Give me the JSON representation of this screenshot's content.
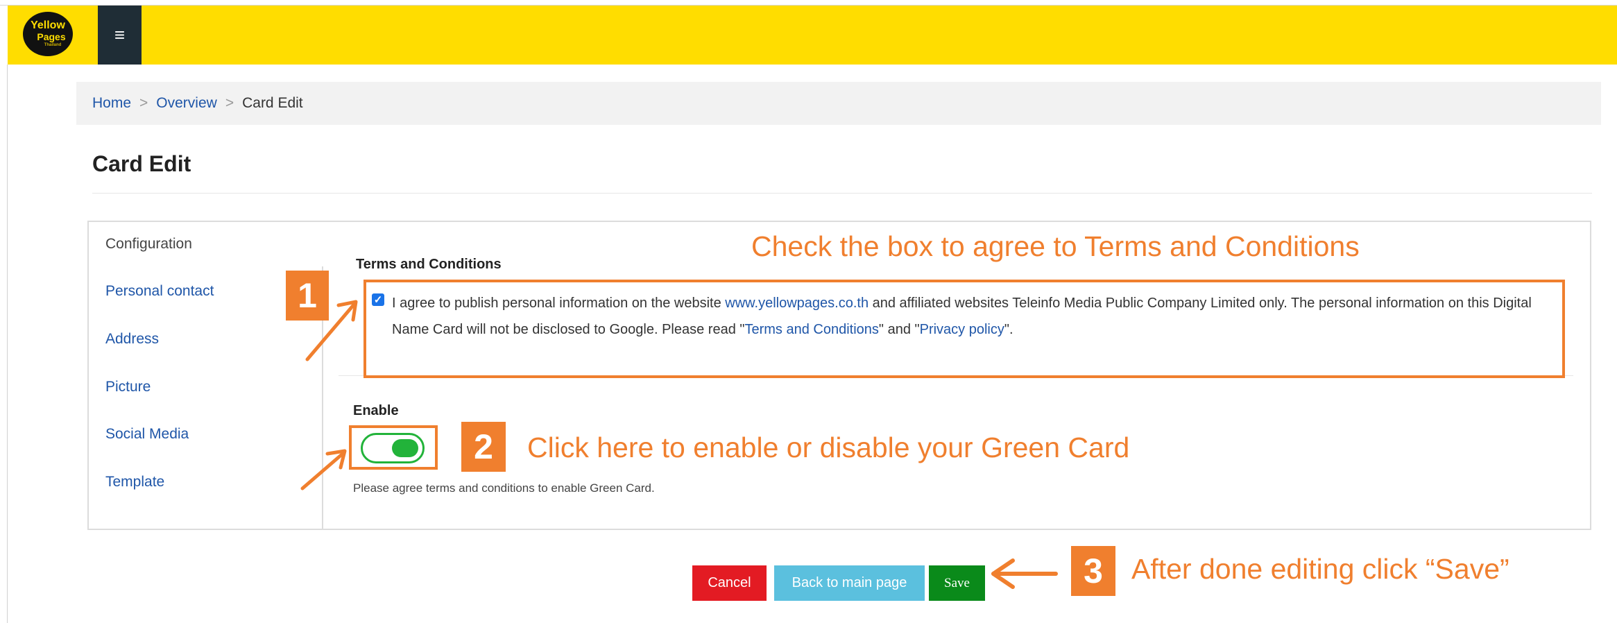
{
  "header": {
    "logo_line1": "Yellow",
    "logo_line2": "Pages",
    "logo_line3": "Thailand",
    "menu_glyph": "≡",
    "colors": {
      "header_bg": "#ffdd00",
      "menu_bg": "#1f2d36"
    }
  },
  "breadcrumb": {
    "items": [
      "Home",
      "Overview",
      "Card Edit"
    ],
    "separator": ">"
  },
  "page_title": "Card Edit",
  "tabs": [
    {
      "label": "Configuration",
      "active": true
    },
    {
      "label": "Personal contact",
      "active": false
    },
    {
      "label": "Address",
      "active": false
    },
    {
      "label": "Picture",
      "active": false
    },
    {
      "label": "Social Media",
      "active": false
    },
    {
      "label": "Template",
      "active": false
    }
  ],
  "terms": {
    "heading": "Terms and Conditions",
    "checked": true,
    "text_part1": "I agree to publish personal information on the website ",
    "link_site": "www.yellowpages.co.th",
    "text_part2": " and affiliated websites Teleinfo Media Public Company Limited only. The personal information on this Digital Name Card will not be disclosed to Google. Please read \"",
    "link_terms": "Terms and Conditions",
    "text_part3": "\" and \"",
    "link_privacy": "Privacy policy",
    "text_part4": "\"."
  },
  "enable": {
    "heading": "Enable",
    "toggle_on": true,
    "hint": "Please agree terms and conditions to enable Green Card."
  },
  "buttons": {
    "cancel": "Cancel",
    "back": "Back to main page",
    "save": "Save",
    "colors": {
      "cancel": "#e31b23",
      "back": "#5bc0de",
      "save": "#0a8a1a"
    }
  },
  "annotations": {
    "color": "#f07f2e",
    "step1_number": "1",
    "step1_text": "Check the box to agree to Terms and Conditions",
    "step2_number": "2",
    "step2_text": "Click here to enable or disable your Green Card",
    "step3_number": "3",
    "step3_text": "After done editing click “Save”"
  }
}
